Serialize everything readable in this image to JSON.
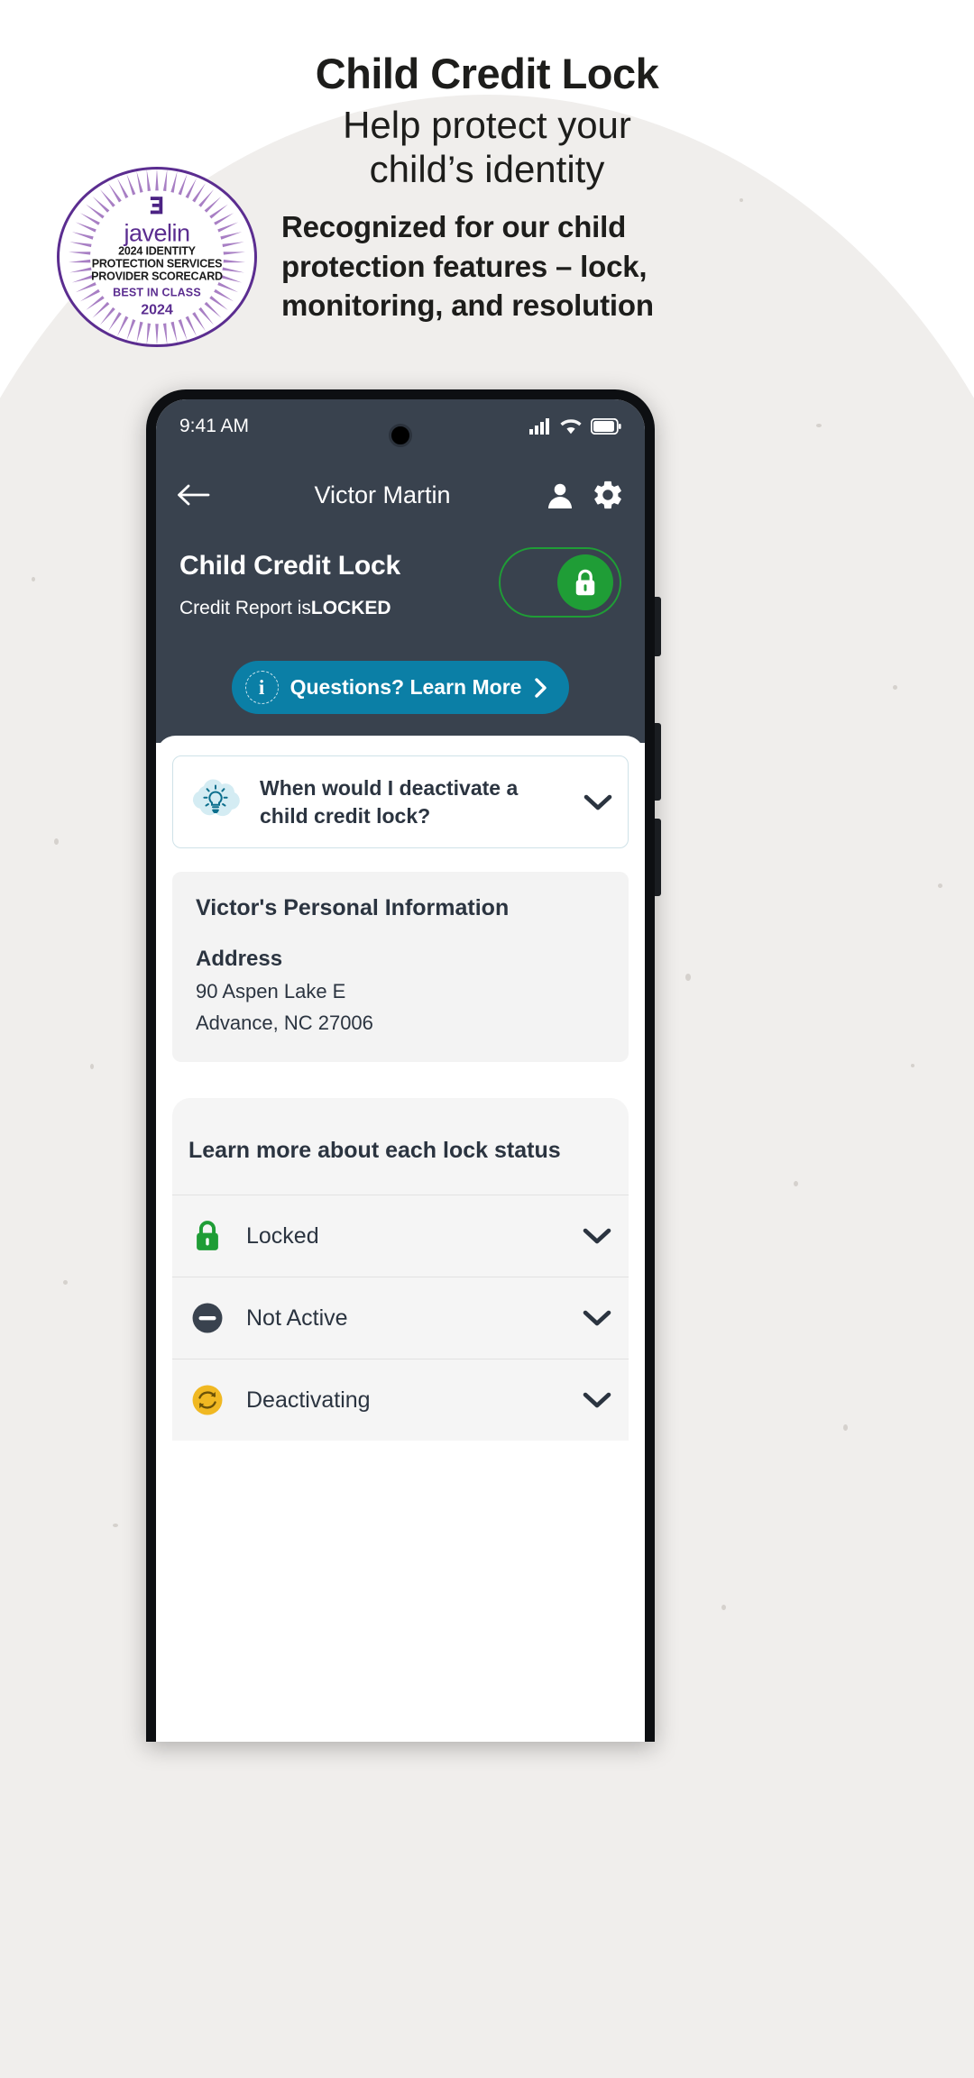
{
  "hero": {
    "title": "Child Credit Lock",
    "subtitle_line1": "Help protect your",
    "subtitle_line2": "child’s identity",
    "body": "Recognized for our child protection features – lock, monitoring, and resolution"
  },
  "badge": {
    "logo_text": "javelin",
    "line1": "2024 IDENTITY",
    "line2": "PROTECTION SERVICES",
    "line3": "PROVIDER SCORECARD",
    "best": "BEST IN CLASS",
    "year": "2024",
    "accent": "#5b2d90"
  },
  "phone": {
    "statusbar": {
      "time": "9:41 AM",
      "signal_icon": "cellular-signal-icon",
      "wifi_icon": "wifi-icon",
      "battery_icon": "battery-icon"
    },
    "header": {
      "back_icon": "back-arrow-icon",
      "title": "Victor Martin",
      "profile_icon": "person-icon",
      "settings_icon": "gear-icon"
    },
    "lock_panel": {
      "title": "Child Credit Lock",
      "status_prefix": "Credit Report is",
      "status_value": "LOCKED",
      "toggle_icon": "lock-icon",
      "toggle_state": "on",
      "toggle_color": "#1f9d36",
      "learn_more_label": "Questions? Learn More",
      "learn_more_icon": "info-icon",
      "learn_more_chevron": "chevron-right-icon",
      "learn_more_color": "#0b7fa6"
    },
    "faq": {
      "icon": "lightbulb-icon",
      "question": "When would I deactivate a child credit lock?",
      "chevron": "chevron-down-icon"
    },
    "personal_info": {
      "title": "Victor's Personal Information",
      "address_label": "Address",
      "address_line1": "90 Aspen Lake E",
      "address_line2": "Advance, NC 27006"
    },
    "lock_status": {
      "heading": "Learn more about each lock status",
      "rows": [
        {
          "label": "Locked",
          "icon": "lock-closed-icon",
          "color": "#1f9d36",
          "chevron": "chevron-down-icon"
        },
        {
          "label": "Not Active",
          "icon": "minus-circle-icon",
          "color": "#39424e",
          "chevron": "chevron-down-icon"
        },
        {
          "label": "Deactivating",
          "icon": "refresh-circle-icon",
          "color": "#f0b822",
          "chevron": "chevron-down-icon"
        }
      ]
    }
  }
}
